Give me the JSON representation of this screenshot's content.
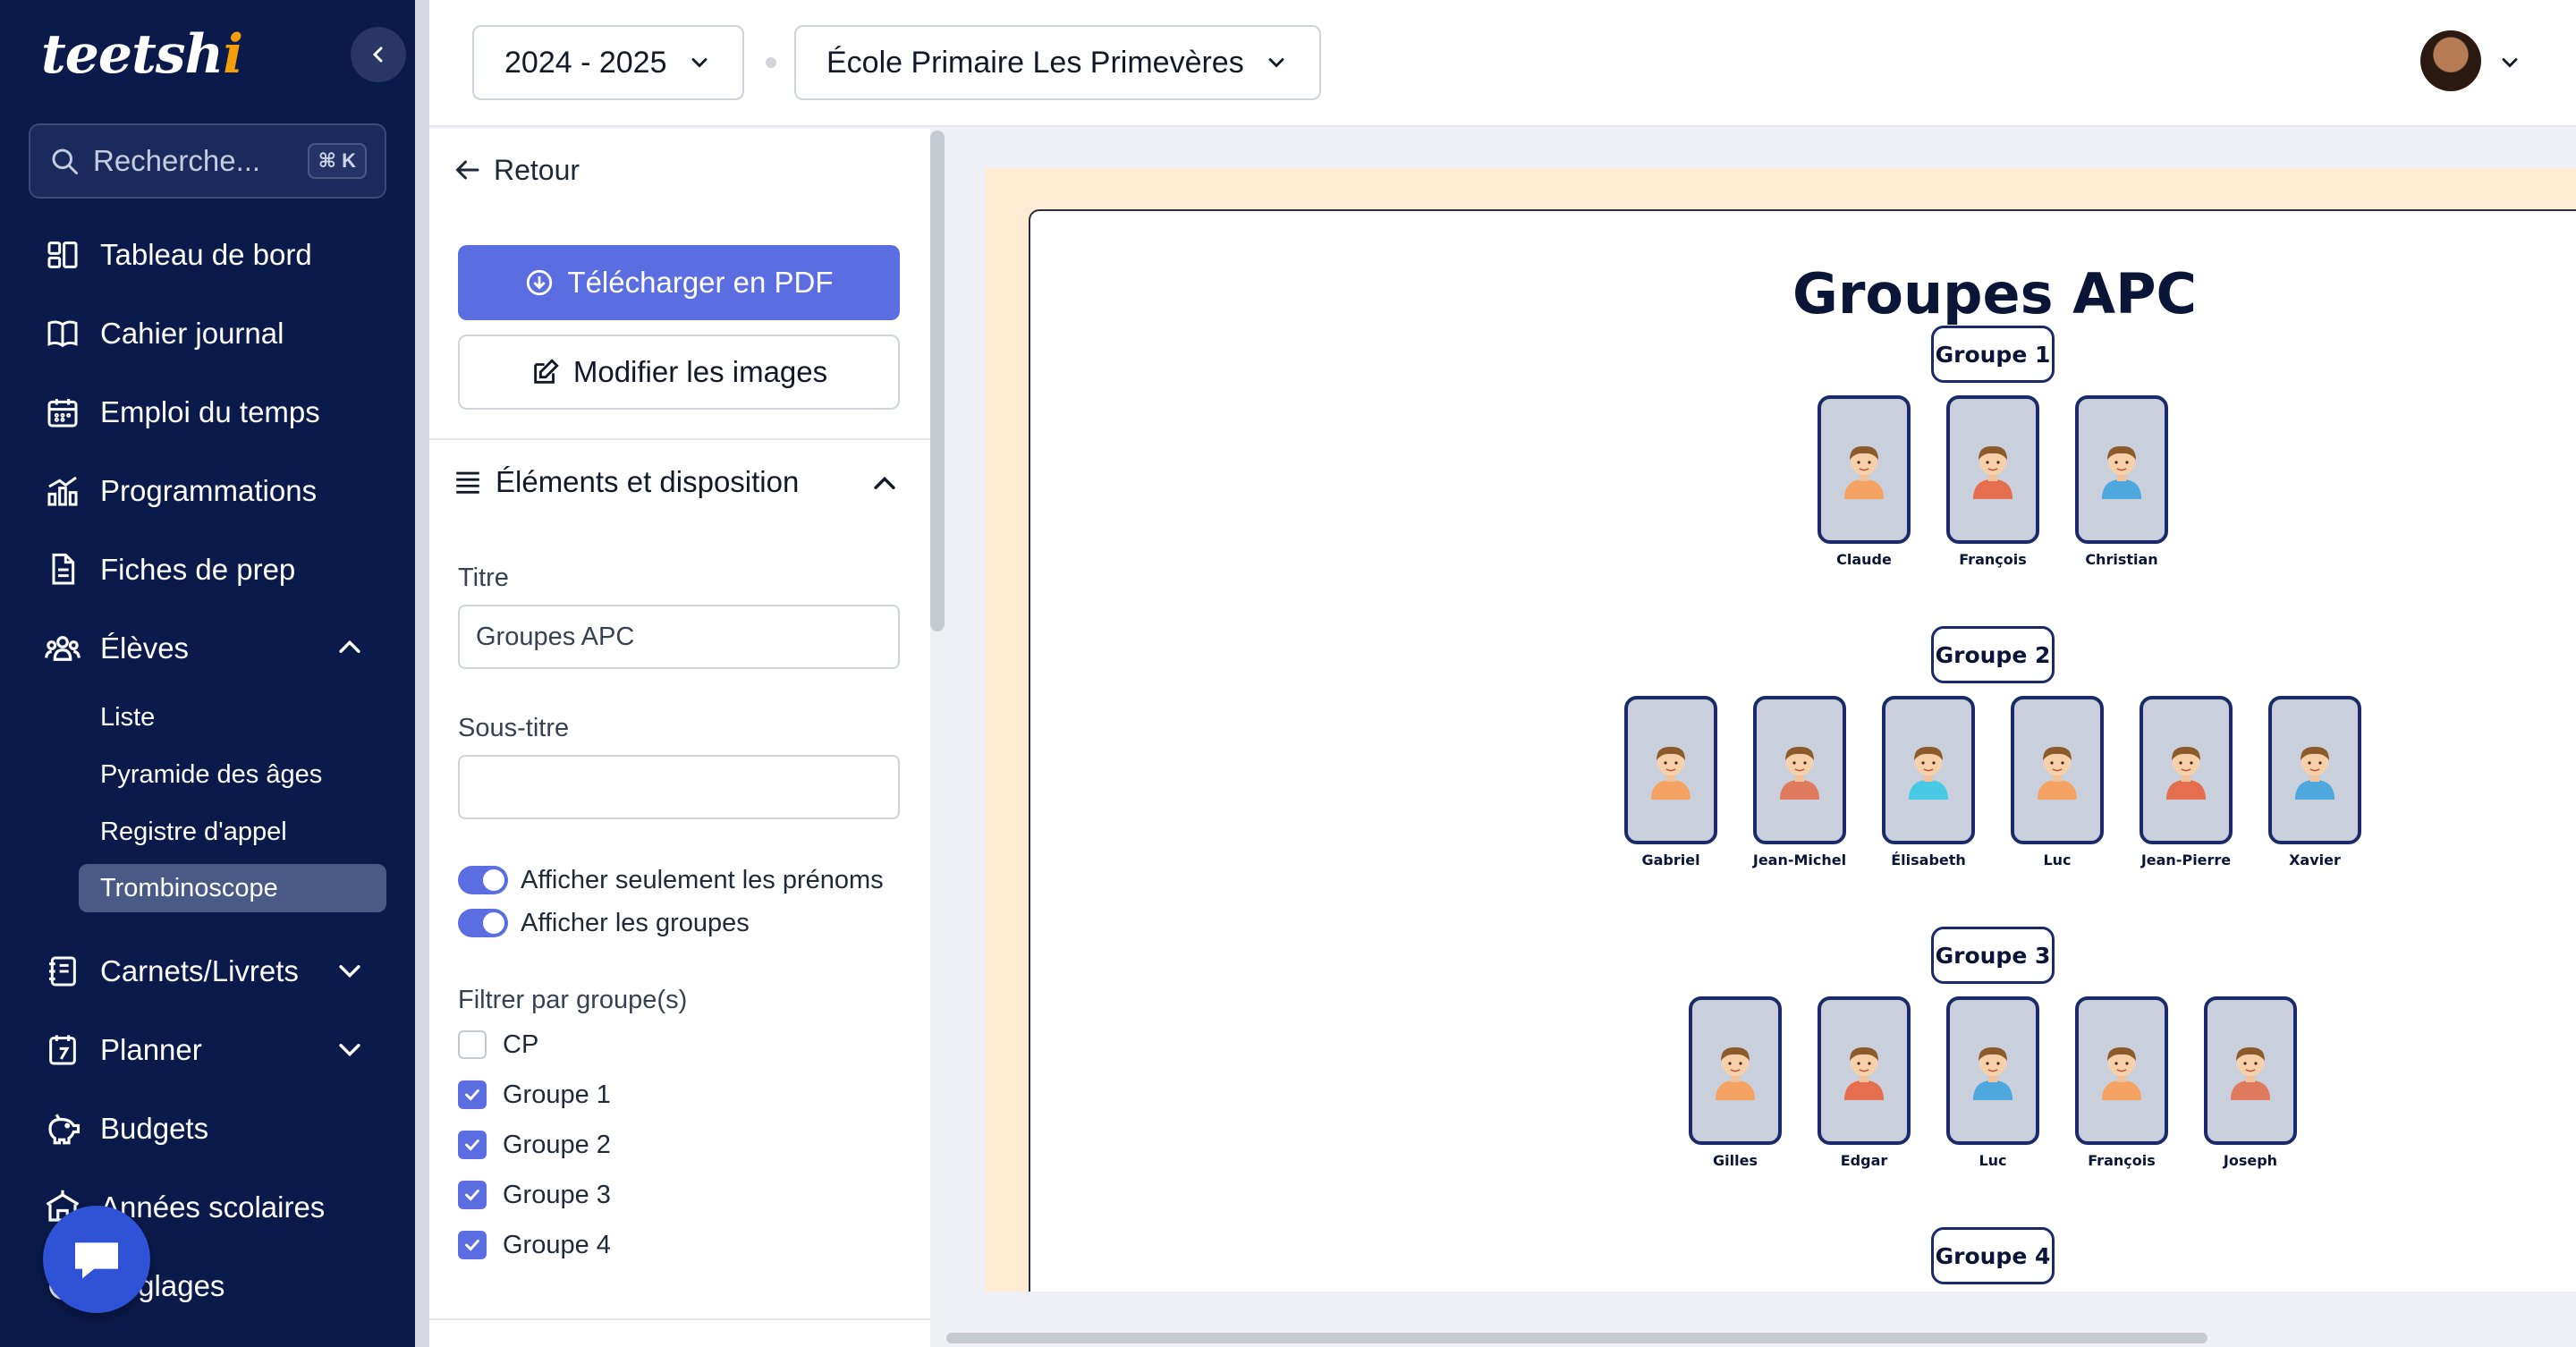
{
  "app": {
    "logo": "teetsh",
    "logo_dot": "i"
  },
  "sidebar": {
    "search_placeholder": "Recherche...",
    "search_shortcut": "⌘ K",
    "items": [
      {
        "label": "Tableau de bord",
        "icon": "dashboard-icon"
      },
      {
        "label": "Cahier journal",
        "icon": "book-icon"
      },
      {
        "label": "Emploi du temps",
        "icon": "calendar-icon"
      },
      {
        "label": "Programmations",
        "icon": "chart-icon"
      },
      {
        "label": "Fiches de prep",
        "icon": "document-icon"
      },
      {
        "label": "Élèves",
        "icon": "users-icon"
      },
      {
        "label": "Carnets/Livrets",
        "icon": "notebook-icon"
      },
      {
        "label": "Planner",
        "icon": "planner-icon"
      },
      {
        "label": "Budgets",
        "icon": "piggy-bank-icon"
      },
      {
        "label": "Années scolaires",
        "icon": "school-icon"
      },
      {
        "label": "Réglages",
        "icon": "settings-icon"
      }
    ],
    "sub_items": [
      "Liste",
      "Pyramide des âges",
      "Registre d'appel",
      "Trombinoscope"
    ],
    "active_sub_item": "Trombinoscope"
  },
  "topbar": {
    "year_select": "2024 - 2025",
    "school_select": "École Primaire Les Primevères"
  },
  "panel": {
    "back_label": "Retour",
    "download_label": "Télécharger en PDF",
    "edit_images_label": "Modifier les images",
    "section_title": "Éléments et disposition",
    "title_label": "Titre",
    "title_value": "Groupes APC",
    "subtitle_label": "Sous-titre",
    "subtitle_value": "",
    "toggle_first_names": "Afficher seulement les prénoms",
    "toggle_groups": "Afficher les groupes",
    "filter_label": "Filtrer par groupe(s)",
    "filters": [
      {
        "label": "CP",
        "checked": false
      },
      {
        "label": "Groupe 1",
        "checked": true
      },
      {
        "label": "Groupe 2",
        "checked": true
      },
      {
        "label": "Groupe 3",
        "checked": true
      },
      {
        "label": "Groupe 4",
        "checked": true
      }
    ]
  },
  "document": {
    "title": "Groupes APC",
    "groups": [
      {
        "label": "Groupe 1",
        "students": [
          "Claude",
          "François",
          "Christian"
        ]
      },
      {
        "label": "Groupe 2",
        "students": [
          "Gabriel",
          "Jean-Michel",
          "Élisabeth",
          "Luc",
          "Jean-Pierre",
          "Xavier"
        ]
      },
      {
        "label": "Groupe 3",
        "students": [
          "Gilles",
          "Edgar",
          "Luc",
          "François",
          "Joseph"
        ]
      },
      {
        "label": "Groupe 4",
        "students": []
      }
    ]
  },
  "colors": {
    "sidebar_bg": "#0a1a4a",
    "accent": "#5b6ee1",
    "page_bg": "#fdebd4",
    "card_border": "#1b2a6b"
  }
}
